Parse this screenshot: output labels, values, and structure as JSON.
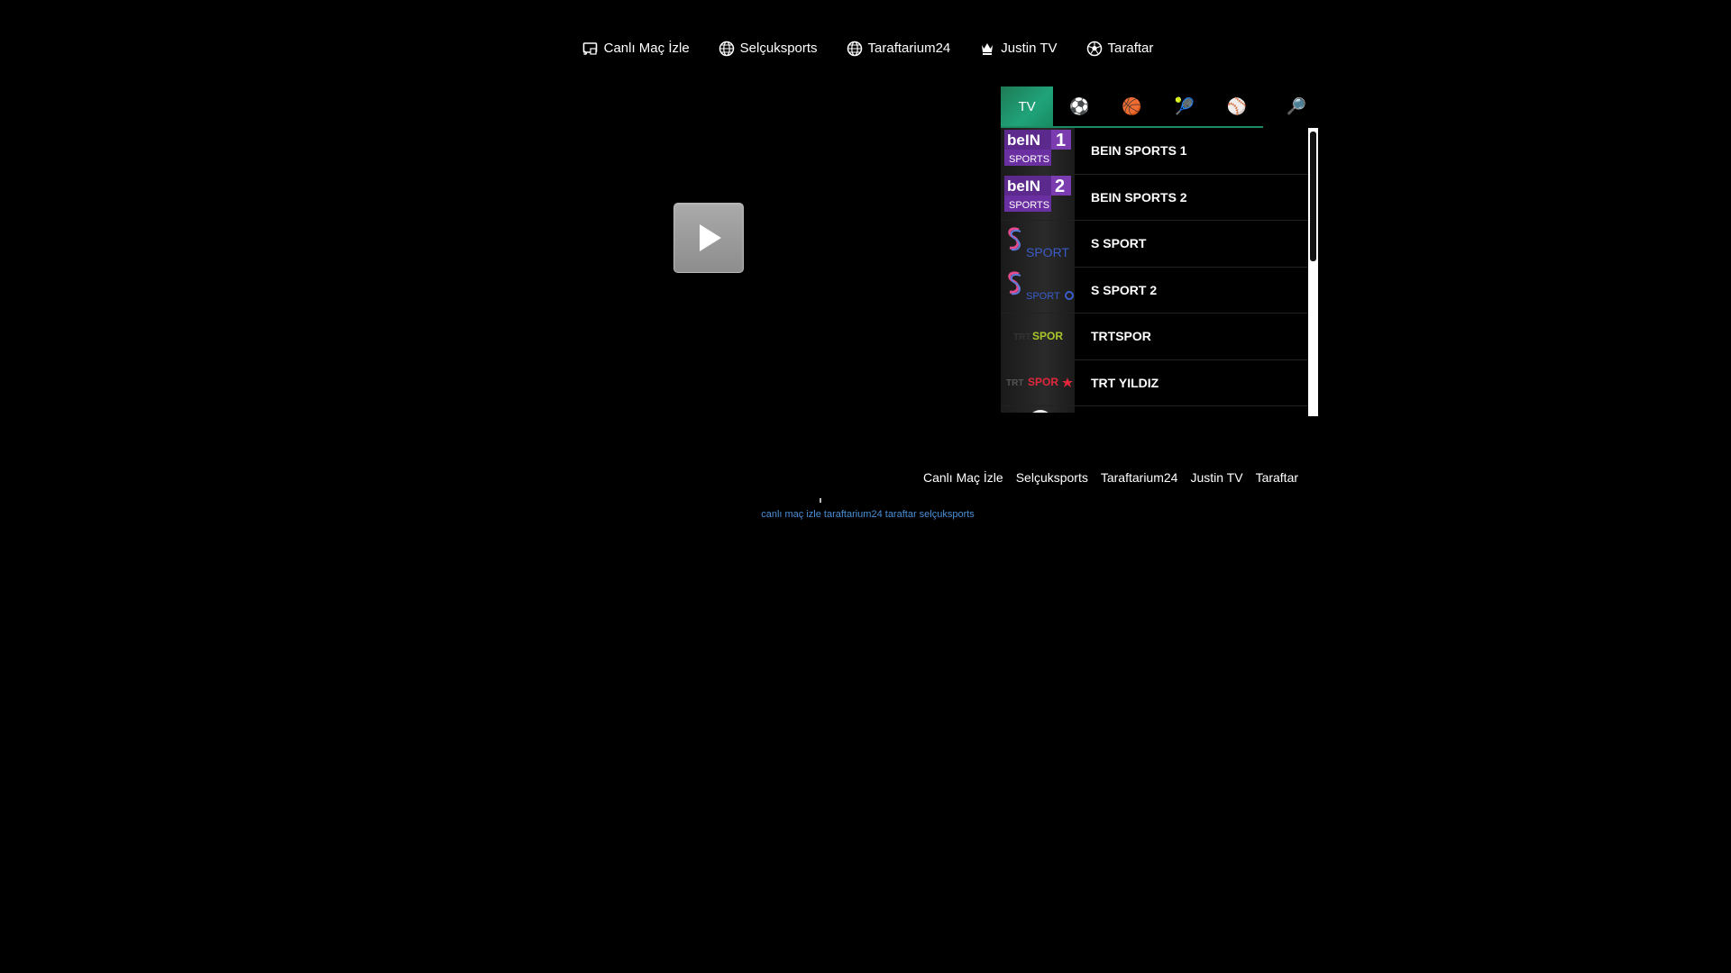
{
  "topnav": [
    {
      "label": "Canlı Maç İzle",
      "icon": "tv-cast-icon"
    },
    {
      "label": "Selçuksports",
      "icon": "globe-icon"
    },
    {
      "label": "Taraftarium24",
      "icon": "globe-icon"
    },
    {
      "label": "Justin TV",
      "icon": "crown-icon"
    },
    {
      "label": "Taraftar",
      "icon": "soccer-ball-icon"
    }
  ],
  "tabs": {
    "tv": "TV",
    "football": "⚽",
    "basketball": "🏀",
    "tennis": "🎾",
    "baseball": "⚾",
    "search": "🔎"
  },
  "channels": [
    {
      "name": "BEIN SPORTS 1",
      "logo": "bein-sports-1"
    },
    {
      "name": "BEIN SPORTS 2",
      "logo": "bein-sports-2"
    },
    {
      "name": "S SPORT",
      "logo": "s-sport"
    },
    {
      "name": "S SPORT 2",
      "logo": "s-sport-2"
    },
    {
      "name": "TRTSPOR",
      "logo": "trt-spor"
    },
    {
      "name": "TRT YILDIZ",
      "logo": "trt-spor-yildiz"
    },
    {
      "name": "",
      "logo": "channel-logo"
    }
  ],
  "bottom_links": [
    "Canlı Maç İzle",
    "Selçuksports",
    "Taraftarium24",
    "Justin TV",
    "Taraftar"
  ],
  "tagline": "canlı maç izle taraftarium24 taraftar selçuksports",
  "colors": {
    "accent_green": "#1c8a62",
    "link_blue": "#4a8fd8",
    "bein_purple": "#5b2a8c",
    "trt_green": "#a8c62a",
    "trt_red": "#e0283c"
  }
}
